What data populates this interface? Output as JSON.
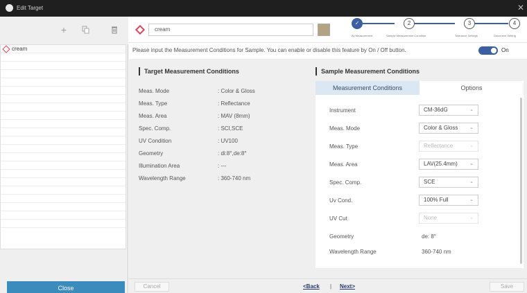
{
  "window": {
    "title": "Edit Target",
    "close_glyph": "✕"
  },
  "sidebar": {
    "toolbar": {
      "add_icon": "plus-icon",
      "copy_icon": "copy-icon",
      "delete_icon": "trash-icon"
    },
    "items": [
      {
        "label": "cream"
      }
    ],
    "close_label": "Close"
  },
  "header": {
    "name_value": "cream",
    "swatch_color": "#b3a383",
    "steps": [
      {
        "label": "By Measurement",
        "state": "done"
      },
      {
        "label": "Sample Measurement Condition",
        "number": "2"
      },
      {
        "label": "Tolerance Settings",
        "number": "3"
      },
      {
        "label": "Document Setting",
        "number": "4"
      }
    ]
  },
  "info": {
    "text": "Please input the Measurement Conditions for Sample. You can enable or disable this feature by On / Off button.",
    "toggle_state": "On"
  },
  "target": {
    "title": "Target Measurement Conditions",
    "rows": [
      {
        "label": "Meas. Mode",
        "value": ": Color & Gloss"
      },
      {
        "label": "Meas. Type",
        "value": ": Reflectance"
      },
      {
        "label": "Meas. Area",
        "value": ": MAV (8mm)"
      },
      {
        "label": "Spec. Comp.",
        "value": ": SCI,SCE"
      },
      {
        "label": "UV Condition",
        "value": ": UV100"
      },
      {
        "label": "Geometry",
        "value": ": di:8°,de:8°"
      },
      {
        "label": "Illumination Area",
        "value": ": ---"
      },
      {
        "label": "Wavelength Range",
        "value": ": 360-740 nm"
      }
    ]
  },
  "sample": {
    "title": "Sample Measurement Conditions",
    "tabs": [
      "Measurement Conditions",
      "Options"
    ],
    "rows": [
      {
        "label": "Instrument",
        "value": "CM-36dG",
        "kind": "dropdown"
      },
      {
        "label": "Meas. Mode",
        "value": "Color & Gloss",
        "kind": "dropdown"
      },
      {
        "label": "Meas. Type",
        "value": "Reflectance",
        "kind": "dropdown-disabled"
      },
      {
        "label": "Meas. Area",
        "value": "LAV(25.4mm)",
        "kind": "dropdown"
      },
      {
        "label": "Spec. Comp.",
        "value": "SCE",
        "kind": "dropdown"
      },
      {
        "label": "Uv Cond.",
        "value": "100% Full",
        "kind": "dropdown"
      },
      {
        "label": "UV Cut",
        "value": "None",
        "kind": "dropdown-disabled"
      },
      {
        "label": "Geometry",
        "value": "de: 8°",
        "kind": "text"
      },
      {
        "label": "Wavelength Range",
        "value": "360-740 nm",
        "kind": "text"
      }
    ]
  },
  "footer": {
    "cancel_label": "Cancel",
    "back_label": "<Back",
    "separator": "|",
    "next_label": "Next>",
    "save_label": "Save"
  }
}
